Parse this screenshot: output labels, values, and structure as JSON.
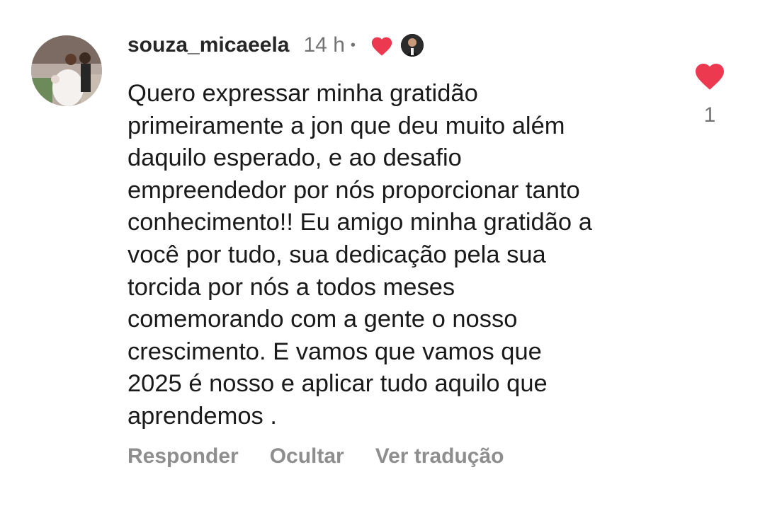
{
  "comment": {
    "username": "souza_micaeela",
    "time": "14 h",
    "separator": "•",
    "text": "Quero expressar minha gratidão\nprimeiramente a jon que deu muito além\ndaquilo esperado, e ao desafio\nempreendedor por nós proporcionar tanto\nconhecimento!! Eu amigo minha gratidão a\nvocê por tudo, sua dedicação pela sua\ntorcida por nós a todos meses\ncomemorando com a gente o nosso\ncrescimento.  E vamos que vamos que\n2025 é nosso e aplicar tudo aquilo que\naprendemos .",
    "like_count": "1",
    "creator_liked": true
  },
  "actions": {
    "reply": "Responder",
    "hide": "Ocultar",
    "translate": "Ver tradução"
  },
  "colors": {
    "heart": "#ed3950",
    "username": "#262626",
    "muted": "#737373",
    "action": "#8e8e8e"
  },
  "icons": {
    "like": "heart-icon",
    "creator_like": "creator-heart-icon"
  }
}
